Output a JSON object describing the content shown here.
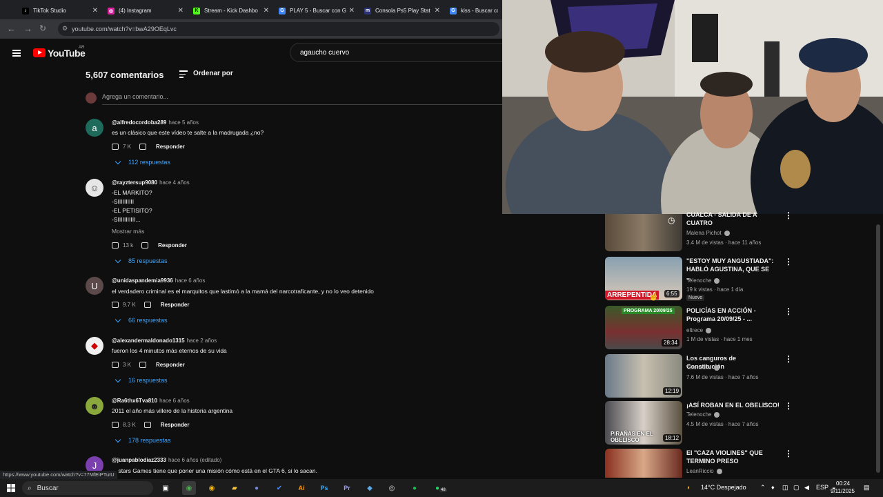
{
  "browser": {
    "tabs": [
      {
        "label": "TikTok Studio",
        "icon": "tiktok-icon",
        "color": "#000000"
      },
      {
        "label": "(4) Instagram",
        "icon": "instagram-icon",
        "color": "#d6249f"
      },
      {
        "label": "Stream - Kick Dashbo",
        "icon": "kick-icon",
        "color": "#53fc18"
      },
      {
        "label": "PLAY 5 - Buscar con G",
        "icon": "google-icon",
        "color": "#4285f4"
      },
      {
        "label": "Consola Ps5 Play Stat",
        "icon": "mercadolibre-icon",
        "color": "#2d3277"
      },
      {
        "label": "kiss - Buscar con G",
        "icon": "google-icon",
        "color": "#4285f4"
      }
    ],
    "url": "youtube.com/watch?v=bwA29OEqLvc",
    "status_url": "https://www.youtube.com/watch?v=77MfEiPTuIU"
  },
  "youtube": {
    "logo_text": "YouTube",
    "region": "AR",
    "search_value": "agaucho cuervo"
  },
  "comments": {
    "count_label": "5,607 comentarios",
    "sort_label": "Ordenar por",
    "add_placeholder": "Agrega un comentario...",
    "items": [
      {
        "handle": "@alfredocordoba289",
        "ago": "hace 5 años",
        "text": "es un clásico que este vídeo te salte a la madrugada ¿no?",
        "likes": "7 K",
        "reply": "Responder",
        "replies": "112 respuestas",
        "avatar": "a",
        "avatar_color": "#1e6b5c"
      },
      {
        "handle": "@rayztersup9080",
        "ago": "hace 4 años",
        "text": "-EL MARKITO?\n-SIIIIIIIIII\n-EL PETISITO?\n-SIIIIIIIIIII...",
        "more": "Mostrar más",
        "likes": "13 k",
        "reply": "Responder",
        "replies": "85 respuestas",
        "avatar": "",
        "avatar_color": "#dddddd"
      },
      {
        "handle": "@unidaspandemia9936",
        "ago": "hace 6 años",
        "text": "el verdadero criminal es el marquitos que lastimó a la mamá del narcotraficante, y no lo veo detenido",
        "likes": "9.7 K",
        "reply": "Responder",
        "replies": "66 respuestas",
        "avatar": "U",
        "avatar_color": "#5c4a4a"
      },
      {
        "handle": "@alexandermaldonado1315",
        "ago": "hace 2 años",
        "text": "fueron los 4 minutos más eternos de su vida",
        "likes": "3 K",
        "reply": "Responder",
        "replies": "16 respuestas",
        "avatar": "",
        "avatar_color": "#eeeeee"
      },
      {
        "handle": "@Ra6thx6Tva810",
        "ago": "hace 6 años",
        "text": "2011 el año más villero de la historia argentina",
        "likes": "8.3 K",
        "reply": "Responder",
        "replies": "178 respuestas",
        "avatar": "",
        "avatar_color": "#8aa83c"
      },
      {
        "handle": "@juanpablodiaz2333",
        "ago": "hace 6 años (editado)",
        "text": "... stars Games tiene que poner una misión cómo está en el GTA 6, si lo sacan.",
        "avatar": "J",
        "avatar_color": "#7b3fb0"
      }
    ]
  },
  "sidebar": {
    "videos": [
      {
        "title": "CUALCA - SALIDA DE A CUATRO",
        "channel": "Malena Pichot",
        "meta": "3.4 M de vistas · hace 11 años"
      },
      {
        "title": "\"ESTOY MUY ANGUSTIADA\": HABLÓ AGUSTINA, QUE SE ...",
        "channel": "Telenoche",
        "meta": "19 k vistas · hace 1 día",
        "badge": "Nuevo",
        "duration": "6:55",
        "overlay": "ARREPENTIDA"
      },
      {
        "title": "POLICÍAS EN ACCIÓN - Programa 20/09/25 - ...",
        "channel": "eltrece",
        "meta": "1 M de vistas · hace 1 mes",
        "duration": "28:34",
        "overlay": "PROGRAMA 20/09/25"
      },
      {
        "title": "Los canguros de Constitución",
        "channel": "Telenoche",
        "meta": "7.6 M de vistas · hace 7 años",
        "duration": "12:19"
      },
      {
        "title": "¡ASÍ ROBAN EN EL OBELISCO!",
        "channel": "Telenoche",
        "meta": "4.5 M de vistas · hace 7 años",
        "duration": "18:12",
        "overlay": "PIRAÑAS EN EL OBELISCO"
      },
      {
        "title": "El \"CAZA VIOLINES\" QUE TERMINO PRESO",
        "channel": "LeanRiccio",
        "meta": ""
      }
    ]
  },
  "taskbar": {
    "search_label": "Buscar",
    "weather": "14°C  Despejado",
    "lang": "ESP",
    "time": "00:24",
    "date": "9/11/2025",
    "notif_count": "48"
  }
}
